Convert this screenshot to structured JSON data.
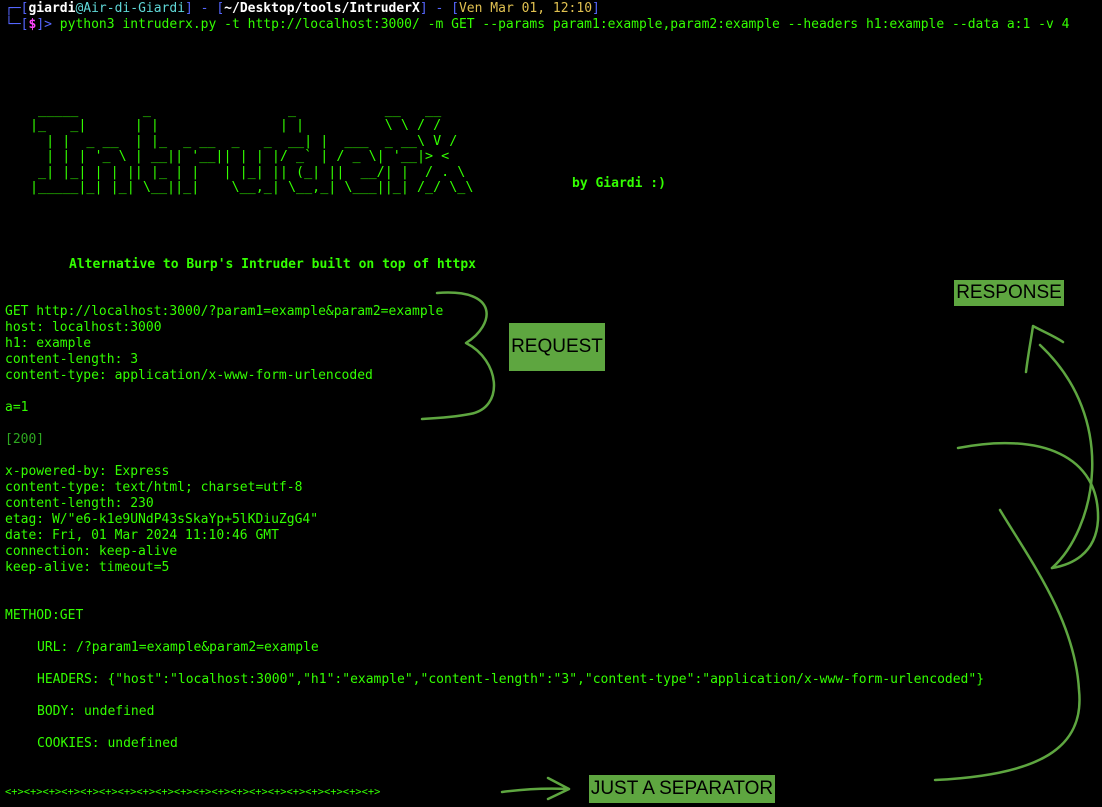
{
  "prompt": {
    "user": "giardi",
    "at": "@",
    "host": "Air-di-Giardi",
    "path": "~/Desktop/tools/IntruderX",
    "date": "Ven Mar 01, 12:10",
    "dollar": "$",
    "command": "python3 intruderx.py -t http://localhost:3000/ -m GET --params param1:example,param2:example --headers h1:example --data a:1 -v 4"
  },
  "banner": {
    "ascii": " _____        _                 _           __   __\n|_   _|      | |               | |          \\ \\ / /\n  | |  _ __  | |_  _ __  _   _  __| |  ___  _ __\\ V / \n  | | | '_ \\ | __|| '__|| | | |/ _` | / _ \\| '__|> <  \n _| |_| | | || |_ | |   | |_| || (_| ||  __/| |  / . \\ \n|_____|_| |_| \\__||_|    \\__,_| \\__,_| \\___||_| /_/ \\_\\",
    "byline": "by Giardi :)",
    "tagline": "Alternative to Burp's Intruder built on top of httpx"
  },
  "request": {
    "request_line": "GET http://localhost:3000/?param1=example&param2=example",
    "headers": [
      "host: localhost:3000",
      "h1: example",
      "content-length: 3",
      "content-type: application/x-www-form-urlencoded"
    ],
    "body": "a=1"
  },
  "response": {
    "status": "[200]",
    "headers": [
      "x-powered-by: Express",
      "content-type: text/html; charset=utf-8",
      "content-length: 230",
      "etag: W/\"e6-k1e9UNdP43sSkaYp+5lKDiuZgG4\"",
      "date: Fri, 01 Mar 2024 11:10:46 GMT",
      "connection: keep-alive",
      "keep-alive: timeout=5"
    ]
  },
  "details": {
    "method": "METHOD:GET",
    "url": "URL: /?param1=example&param2=example",
    "headers": "HEADERS: {\"host\":\"localhost:3000\",\"h1\":\"example\",\"content-length\":\"3\",\"content-type\":\"application/x-www-form-urlencoded\"}",
    "body": "BODY: undefined",
    "cookies": "COOKIES: undefined"
  },
  "separator": "<+><+><+><+><+><+><+><+><+><+><+><+><+><+><+><+><+><+><+><+>",
  "annotations": {
    "request": "REQUEST",
    "response": "RESPONSE",
    "separator": "JUST A SEPARATOR"
  },
  "colors": {
    "terminal_green": "#33ff00",
    "annotation_green": "#5ea640"
  }
}
